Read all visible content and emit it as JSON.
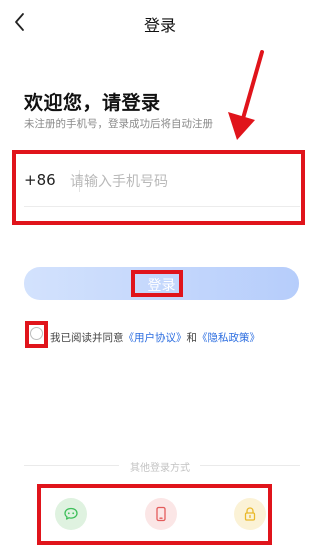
{
  "header": {
    "title": "登录",
    "back_icon": "chevron-left-icon"
  },
  "welcome": {
    "title": "欢迎您，请登录",
    "hint": "未注册的手机号，登录成功后将自动注册"
  },
  "phone": {
    "prefix": "+86",
    "placeholder": "请输入手机号码",
    "value": ""
  },
  "login_button": {
    "label": "登录"
  },
  "agreement": {
    "prefix": "我已阅读并同意",
    "user_agreement": "《用户协议》",
    "and": "和",
    "privacy_policy": "《隐私政策》"
  },
  "other_login": {
    "title": "其他登录方式",
    "options": [
      {
        "icon": "wechat-icon",
        "color": "#3fbf5b"
      },
      {
        "icon": "phone-icon",
        "color": "#e35b5b"
      },
      {
        "icon": "lock-icon",
        "color": "#e9b829"
      }
    ]
  },
  "colors": {
    "accent": "#2b6de0",
    "annotation_red": "#e0141b",
    "login_gradient_start": "#d3e2fd",
    "login_gradient_end": "#b6cdfb"
  }
}
